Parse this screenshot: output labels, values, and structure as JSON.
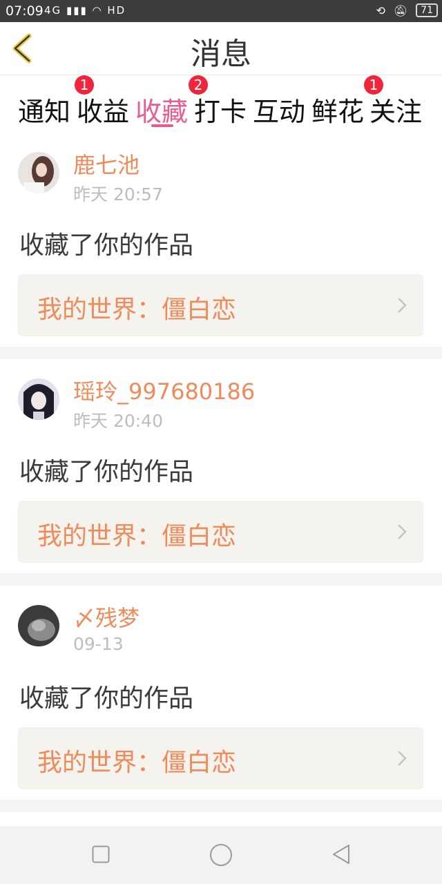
{
  "status_bar": {
    "time": "07:09",
    "signal": "4G",
    "network": "HD",
    "battery": "71"
  },
  "header": {
    "title": "消息"
  },
  "tabs": [
    {
      "label": "通知",
      "badge": "1"
    },
    {
      "label": "收益",
      "badge": ""
    },
    {
      "label": "收藏",
      "badge": "2",
      "active": true
    },
    {
      "label": "打卡",
      "badge": ""
    },
    {
      "label": "互动",
      "badge": ""
    },
    {
      "label": "鲜花",
      "badge": ""
    },
    {
      "label": "关注",
      "badge": "1"
    }
  ],
  "messages": [
    {
      "user": "鹿七池",
      "time": "昨天 20:57",
      "action": "收藏了你的作品",
      "work": "我的世界：僵白恋"
    },
    {
      "user": "瑶玲_997680186",
      "time": "昨天 20:40",
      "action": "收藏了你的作品",
      "work": "我的世界：僵白恋"
    },
    {
      "user": "〆残梦",
      "time": "09-13",
      "action": "收藏了你的作品",
      "work": "我的世界：僵白恋"
    }
  ],
  "colors": {
    "accent": "#ea5b8e",
    "username": "#ef8a5a",
    "badge": "#f0243a"
  },
  "icons": {
    "back": "chevron-left-icon",
    "work_arrow": "chevron-right-icon",
    "nav": [
      "square-icon",
      "circle-icon",
      "triangle-left-icon"
    ]
  }
}
